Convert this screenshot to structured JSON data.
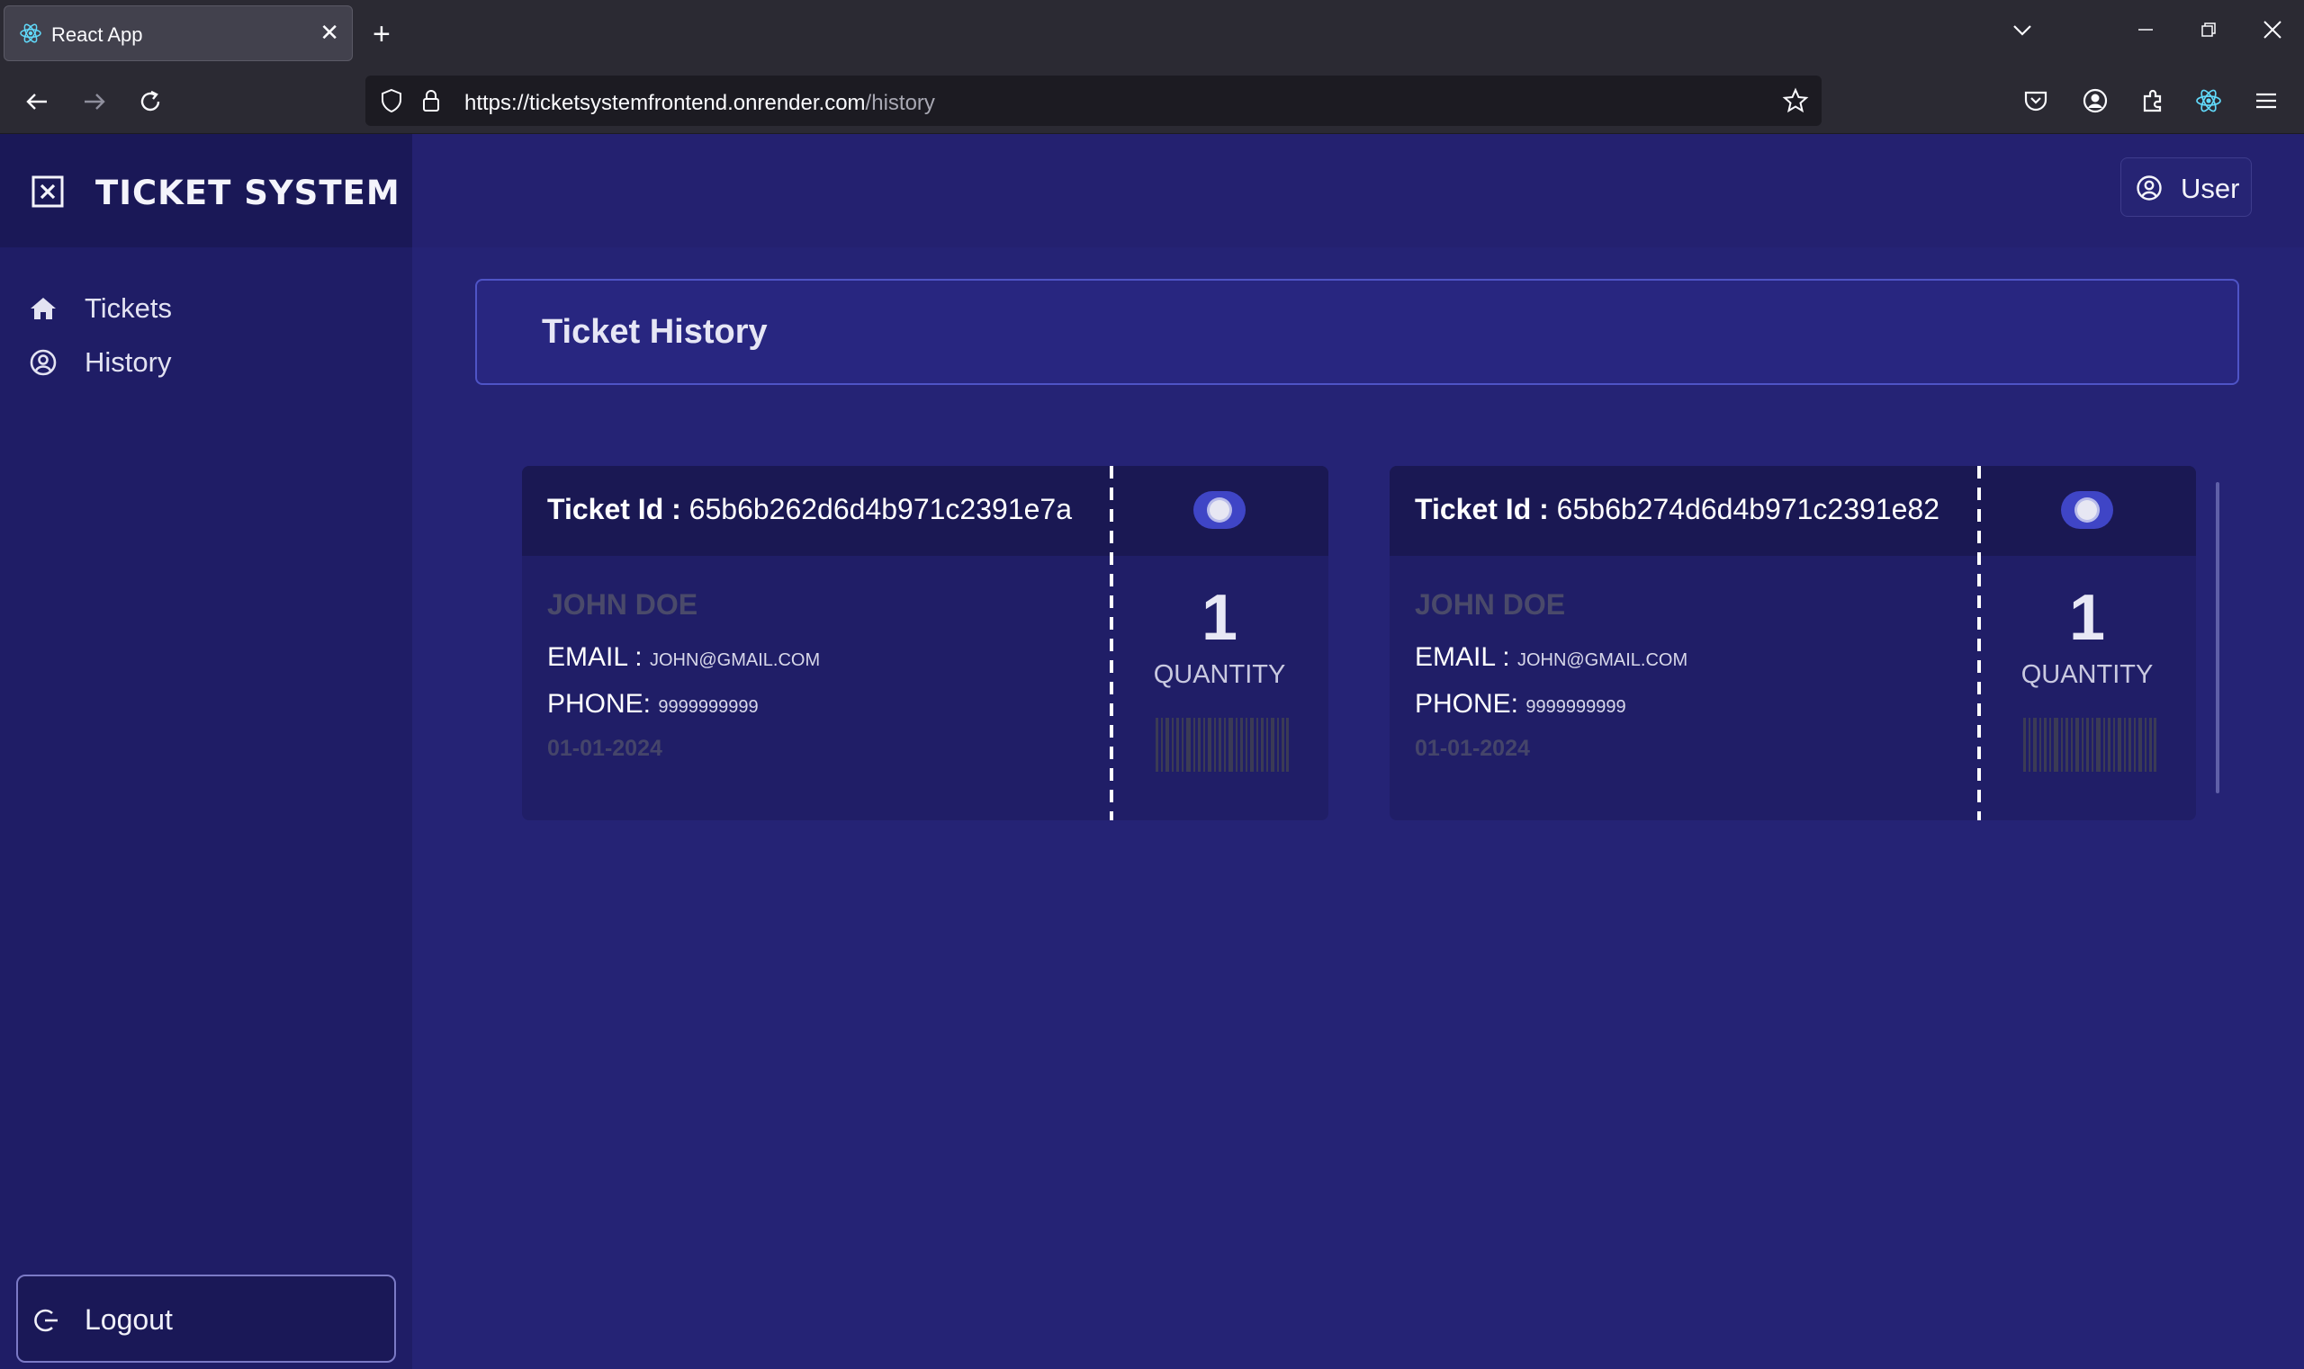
{
  "browser": {
    "tab_title": "React App",
    "tab_close": "✕",
    "new_tab": "+",
    "url_host": "https://ticketsystemfrontend.onrender.com",
    "url_path": "/history"
  },
  "app": {
    "brand": "TICKET SYSTEM",
    "sidebar": {
      "items": [
        {
          "label": "Tickets",
          "icon": "home-icon"
        },
        {
          "label": "History",
          "icon": "user-circle-icon"
        }
      ],
      "logout_label": "Logout"
    },
    "user_label": "User",
    "page_title": "Ticket History",
    "tickets": [
      {
        "id_label": "Ticket Id :",
        "id": "65b6b262d6d4b971c2391e7a",
        "name": "JOHN DOE",
        "email_label": "EMAIL :",
        "email": "JOHN@GMAIL.COM",
        "phone_label": "PHONE:",
        "phone": "9999999999",
        "date": "01-01-2024",
        "quantity": "1",
        "quantity_label": "QUANTITY"
      },
      {
        "id_label": "Ticket Id :",
        "id": "65b6b274d6d4b971c2391e82",
        "name": "JOHN DOE",
        "email_label": "EMAIL :",
        "email": "JOHN@GMAIL.COM",
        "phone_label": "PHONE:",
        "phone": "9999999999",
        "date": "01-01-2024",
        "quantity": "1",
        "quantity_label": "QUANTITY"
      }
    ]
  },
  "colors": {
    "background": "#252375",
    "sidebar": "#1f1d66",
    "accent": "#3f45c6"
  }
}
